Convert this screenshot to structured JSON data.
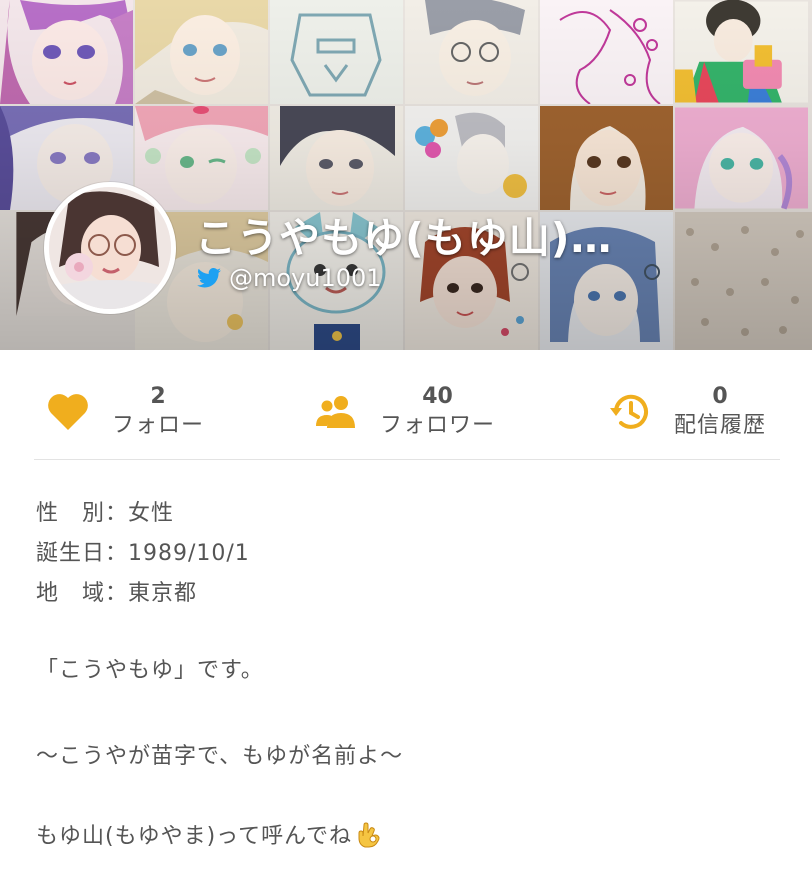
{
  "profile": {
    "name": "こうやもゆ(もゆ山)…",
    "handle": "@moyu1001",
    "avatar_icon": "profile-photo",
    "social_icon": "twitter-bird-icon"
  },
  "stats": [
    {
      "count": "2",
      "label": "フォロー",
      "icon": "heart-icon"
    },
    {
      "count": "40",
      "label": "フォロワー",
      "icon": "people-icon"
    },
    {
      "count": "0",
      "label": "配信履歴",
      "icon": "history-clock-icon"
    }
  ],
  "info": {
    "gender": "性　別：女性",
    "birthday": "誕生日：1989/10/1",
    "region": "地　域：東京都"
  },
  "bio": {
    "line1": "「こうやもゆ」です。",
    "line2": "〜こうやが苗字で、もゆが名前よ〜",
    "line3": "もゆ山(もゆやま)って呼んでね",
    "line3_emoji": "ok-hand-emoji"
  },
  "colors": {
    "accent": "#F0AE1E",
    "text": "#555555",
    "twitter": "#1DA1F2"
  }
}
